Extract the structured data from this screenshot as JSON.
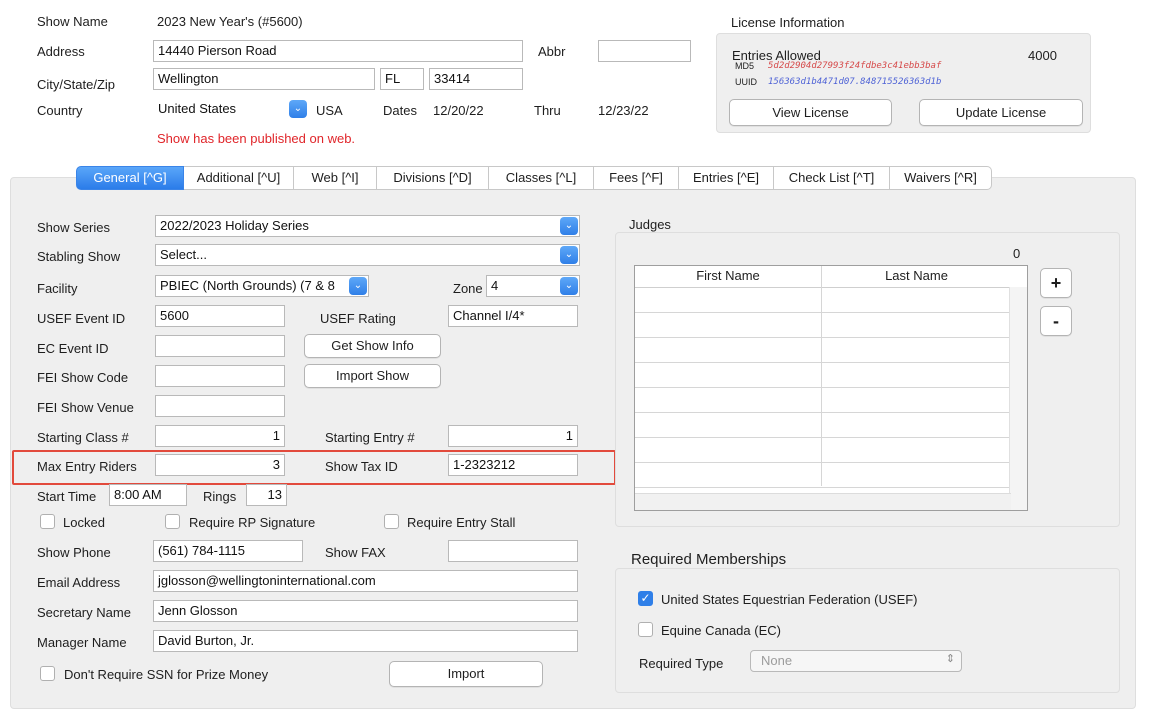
{
  "header": {
    "show_name_label": "Show Name",
    "show_name_value": "2023 New Year's (#5600)",
    "address_label": "Address",
    "address_value": "14440 Pierson Road",
    "abbr_label": "Abbr",
    "abbr_value": "",
    "city_label": "City/State/Zip",
    "city_value": "Wellington",
    "state_value": "FL",
    "zip_value": "33414",
    "country_label": "Country",
    "country_value": "United States",
    "country_code": "USA",
    "dates_label": "Dates",
    "dates_value": "12/20/22",
    "thru_label": "Thru",
    "thru_value": "12/23/22",
    "published_notice": "Show has been published on web."
  },
  "license": {
    "title": "License Information",
    "entries_label": "Entries Allowed",
    "entries_value": "4000",
    "md5_label": "MD5",
    "md5_value": "5d2d2904d27993f24fdbe3c41ebb3baf",
    "uuid_label": "UUID",
    "uuid_value": "156363d1b4471d07.848715526363d1b",
    "view_button": "View License",
    "update_button": "Update License"
  },
  "tabs": [
    {
      "label": "General [^G]",
      "active": true
    },
    {
      "label": "Additional [^U]"
    },
    {
      "label": "Web [^I]"
    },
    {
      "label": "Divisions [^D]"
    },
    {
      "label": "Classes [^L]"
    },
    {
      "label": "Fees [^F]"
    },
    {
      "label": "Entries [^E]"
    },
    {
      "label": "Check List [^T]"
    },
    {
      "label": "Waivers [^R]"
    }
  ],
  "general": {
    "show_series_label": "Show Series",
    "show_series_value": "2022/2023 Holiday Series",
    "stabling_label": "Stabling Show",
    "stabling_value": "Select...",
    "facility_label": "Facility",
    "facility_value": "PBIEC (North Grounds) (7 & 8",
    "zone_label": "Zone",
    "zone_value": "4",
    "usef_event_label": "USEF Event ID",
    "usef_event_value": "5600",
    "usef_rating_label": "USEF Rating",
    "usef_rating_value": "Channel I/4*",
    "ec_event_label": "EC Event ID",
    "ec_event_value": "",
    "get_show_info_button": "Get Show Info",
    "fei_code_label": "FEI Show Code",
    "fei_code_value": "",
    "import_show_button": "Import Show",
    "fei_venue_label": "FEI Show Venue",
    "fei_venue_value": "",
    "starting_class_label": "Starting Class #",
    "starting_class_value": "1",
    "starting_entry_label": "Starting Entry #",
    "starting_entry_value": "1",
    "max_entry_label": "Max Entry Riders",
    "max_entry_value": "3",
    "tax_id_label": "Show Tax ID",
    "tax_id_value": "1-2323212",
    "start_time_label": "Start Time",
    "start_time_value": "8:00 AM",
    "rings_label": "Rings",
    "rings_value": "13",
    "locked_label": "Locked",
    "require_rp_label": "Require RP Signature",
    "require_stall_label": "Require Entry Stall",
    "phone_label": "Show Phone",
    "phone_value": "(561) 784-1115",
    "fax_label": "Show FAX",
    "fax_value": "",
    "email_label": "Email Address",
    "email_value": "jglosson@wellingtoninternational.com",
    "secretary_label": "Secretary Name",
    "secretary_value": "Jenn Glosson",
    "manager_label": "Manager Name",
    "manager_value": "David Burton, Jr.",
    "ssn_label": "Don't Require SSN for Prize Money",
    "import_button": "Import"
  },
  "judges": {
    "title": "Judges",
    "count": "0",
    "col_first": "First Name",
    "col_last": "Last Name",
    "add_button": "+",
    "remove_button": "-"
  },
  "memberships": {
    "title": "Required Memberships",
    "usef_label": "United States Equestrian Federation (USEF)",
    "usef_checked": true,
    "ec_label": "Equine Canada (EC)",
    "ec_checked": false,
    "type_label": "Required Type",
    "type_value": "None"
  },
  "colors": {
    "accent": "#2f7fe8",
    "notice": "#e0252a",
    "highlight": "#e24a3c"
  }
}
